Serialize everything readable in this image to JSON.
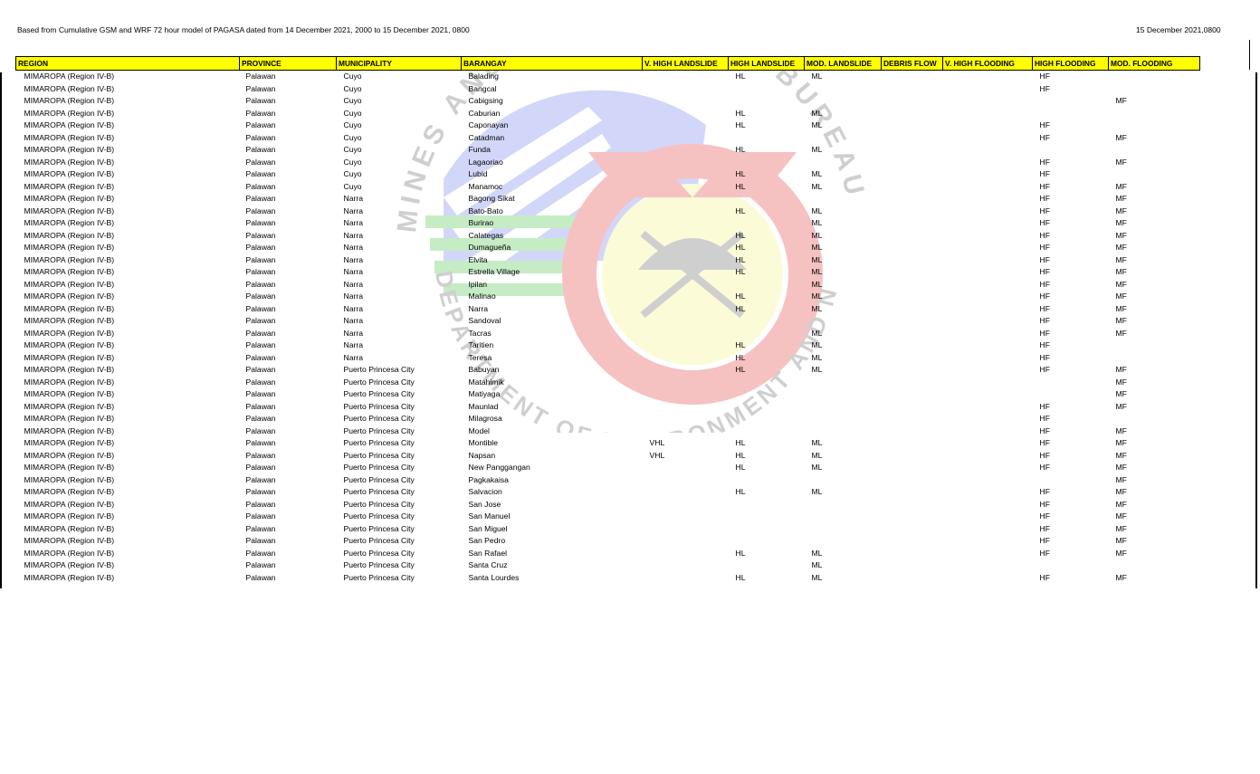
{
  "header": {
    "note": "Based from Cumulative GSM and WRF 72 hour model of PAGASA dated from 14 December 2021, 2000 to 15 December 2021, 0800",
    "date": "15 December 2021,0800"
  },
  "watermark": {
    "top_text": "MINES AND GEOSCIENCES BUREAU",
    "bottom_text": "DEPARTMENT OF ENVIRONMENT AND NATURAL RESOURCES"
  },
  "table": {
    "columns": [
      "REGION",
      "PROVINCE",
      "MUNICIPALITY",
      "BARANGAY",
      "V. HIGH LANDSLIDE",
      "HIGH LANDSLIDE",
      "MOD. LANDSLIDE",
      "DEBRIS FLOW",
      "V. HIGH FLOODING",
      "HIGH FLOODING",
      "MOD. FLOODING"
    ],
    "rows": [
      [
        "MIMAROPA (Region IV-B)",
        "Palawan",
        "Cuyo",
        "Balading",
        "",
        "HL",
        "ML",
        "",
        "",
        "HF",
        ""
      ],
      [
        "MIMAROPA (Region IV-B)",
        "Palawan",
        "Cuyo",
        "Bangcal",
        "",
        "",
        "",
        "",
        "",
        "HF",
        ""
      ],
      [
        "MIMAROPA (Region IV-B)",
        "Palawan",
        "Cuyo",
        "Cabigsing",
        "",
        "",
        "",
        "",
        "",
        "",
        "MF"
      ],
      [
        "MIMAROPA (Region IV-B)",
        "Palawan",
        "Cuyo",
        "Caburian",
        "",
        "HL",
        "ML",
        "",
        "",
        "",
        ""
      ],
      [
        "MIMAROPA (Region IV-B)",
        "Palawan",
        "Cuyo",
        "Caponayan",
        "",
        "HL",
        "ML",
        "",
        "",
        "HF",
        ""
      ],
      [
        "MIMAROPA (Region IV-B)",
        "Palawan",
        "Cuyo",
        "Catadman",
        "",
        "",
        "",
        "",
        "",
        "HF",
        "MF"
      ],
      [
        "MIMAROPA (Region IV-B)",
        "Palawan",
        "Cuyo",
        "Funda",
        "",
        "HL",
        "ML",
        "",
        "",
        "",
        ""
      ],
      [
        "MIMAROPA (Region IV-B)",
        "Palawan",
        "Cuyo",
        "Lagaoriao",
        "",
        "",
        "",
        "",
        "",
        "HF",
        "MF"
      ],
      [
        "MIMAROPA (Region IV-B)",
        "Palawan",
        "Cuyo",
        "Lubid",
        "",
        "HL",
        "ML",
        "",
        "",
        "HF",
        ""
      ],
      [
        "MIMAROPA (Region IV-B)",
        "Palawan",
        "Cuyo",
        "Manamoc",
        "",
        "HL",
        "ML",
        "",
        "",
        "HF",
        "MF"
      ],
      [
        "MIMAROPA (Region IV-B)",
        "Palawan",
        "Narra",
        "Bagong Sikat",
        "",
        "",
        "",
        "",
        "",
        "HF",
        "MF"
      ],
      [
        "MIMAROPA (Region IV-B)",
        "Palawan",
        "Narra",
        "Bato-Bato",
        "",
        "HL",
        "ML",
        "",
        "",
        "HF",
        "MF"
      ],
      [
        "MIMAROPA (Region IV-B)",
        "Palawan",
        "Narra",
        "Burirao",
        "",
        "",
        "ML",
        "",
        "",
        "HF",
        "MF"
      ],
      [
        "MIMAROPA (Region IV-B)",
        "Palawan",
        "Narra",
        "Calategas",
        "",
        "HL",
        "ML",
        "",
        "",
        "HF",
        "MF"
      ],
      [
        "MIMAROPA (Region IV-B)",
        "Palawan",
        "Narra",
        "Dumagueña",
        "",
        "HL",
        "ML",
        "",
        "",
        "HF",
        "MF"
      ],
      [
        "MIMAROPA (Region IV-B)",
        "Palawan",
        "Narra",
        "Elvita",
        "",
        "HL",
        "ML",
        "",
        "",
        "HF",
        "MF"
      ],
      [
        "MIMAROPA (Region IV-B)",
        "Palawan",
        "Narra",
        "Estrella Village",
        "",
        "HL",
        "ML",
        "",
        "",
        "HF",
        "MF"
      ],
      [
        "MIMAROPA (Region IV-B)",
        "Palawan",
        "Narra",
        "Ipilan",
        "",
        "",
        "ML",
        "",
        "",
        "HF",
        "MF"
      ],
      [
        "MIMAROPA (Region IV-B)",
        "Palawan",
        "Narra",
        "Malinao",
        "",
        "HL",
        "ML",
        "",
        "",
        "HF",
        "MF"
      ],
      [
        "MIMAROPA (Region IV-B)",
        "Palawan",
        "Narra",
        "Narra",
        "",
        "HL",
        "ML",
        "",
        "",
        "HF",
        "MF"
      ],
      [
        "MIMAROPA (Region IV-B)",
        "Palawan",
        "Narra",
        "Sandoval",
        "",
        "",
        "",
        "",
        "",
        "HF",
        "MF"
      ],
      [
        "MIMAROPA (Region IV-B)",
        "Palawan",
        "Narra",
        "Tacras",
        "",
        "",
        "ML",
        "",
        "",
        "HF",
        "MF"
      ],
      [
        "MIMAROPA (Region IV-B)",
        "Palawan",
        "Narra",
        "Taritien",
        "",
        "HL",
        "ML",
        "",
        "",
        "HF",
        ""
      ],
      [
        "MIMAROPA (Region IV-B)",
        "Palawan",
        "Narra",
        "Teresa",
        "",
        "HL",
        "ML",
        "",
        "",
        "HF",
        ""
      ],
      [
        "MIMAROPA (Region IV-B)",
        "Palawan",
        "Puerto Princesa City",
        "Babuyan",
        "",
        "HL",
        "ML",
        "",
        "",
        "HF",
        "MF"
      ],
      [
        "MIMAROPA (Region IV-B)",
        "Palawan",
        "Puerto Princesa City",
        "Matahimik",
        "",
        "",
        "",
        "",
        "",
        "",
        "MF"
      ],
      [
        "MIMAROPA (Region IV-B)",
        "Palawan",
        "Puerto Princesa City",
        "Matiyaga",
        "",
        "",
        "",
        "",
        "",
        "",
        "MF"
      ],
      [
        "MIMAROPA (Region IV-B)",
        "Palawan",
        "Puerto Princesa City",
        "Maunlad",
        "",
        "",
        "",
        "",
        "",
        "HF",
        "MF"
      ],
      [
        "MIMAROPA (Region IV-B)",
        "Palawan",
        "Puerto Princesa City",
        "Milagrosa",
        "",
        "",
        "",
        "",
        "",
        "HF",
        ""
      ],
      [
        "MIMAROPA (Region IV-B)",
        "Palawan",
        "Puerto Princesa City",
        "Model",
        "",
        "",
        "",
        "",
        "",
        "HF",
        "MF"
      ],
      [
        "MIMAROPA (Region IV-B)",
        "Palawan",
        "Puerto Princesa City",
        "Montible",
        "VHL",
        "HL",
        "ML",
        "",
        "",
        "HF",
        "MF"
      ],
      [
        "MIMAROPA (Region IV-B)",
        "Palawan",
        "Puerto Princesa City",
        "Napsan",
        "VHL",
        "HL",
        "ML",
        "",
        "",
        "HF",
        "MF"
      ],
      [
        "MIMAROPA (Region IV-B)",
        "Palawan",
        "Puerto Princesa City",
        "New Panggangan",
        "",
        "HL",
        "ML",
        "",
        "",
        "HF",
        "MF"
      ],
      [
        "MIMAROPA (Region IV-B)",
        "Palawan",
        "Puerto Princesa City",
        "Pagkakaisa",
        "",
        "",
        "",
        "",
        "",
        "",
        "MF"
      ],
      [
        "MIMAROPA (Region IV-B)",
        "Palawan",
        "Puerto Princesa City",
        "Salvacion",
        "",
        "HL",
        "ML",
        "",
        "",
        "HF",
        "MF"
      ],
      [
        "MIMAROPA (Region IV-B)",
        "Palawan",
        "Puerto Princesa City",
        "San Jose",
        "",
        "",
        "",
        "",
        "",
        "HF",
        "MF"
      ],
      [
        "MIMAROPA (Region IV-B)",
        "Palawan",
        "Puerto Princesa City",
        "San Manuel",
        "",
        "",
        "",
        "",
        "",
        "HF",
        "MF"
      ],
      [
        "MIMAROPA (Region IV-B)",
        "Palawan",
        "Puerto Princesa City",
        "San Miguel",
        "",
        "",
        "",
        "",
        "",
        "HF",
        "MF"
      ],
      [
        "MIMAROPA (Region IV-B)",
        "Palawan",
        "Puerto Princesa City",
        "San Pedro",
        "",
        "",
        "",
        "",
        "",
        "HF",
        "MF"
      ],
      [
        "MIMAROPA (Region IV-B)",
        "Palawan",
        "Puerto Princesa City",
        "San Rafael",
        "",
        "HL",
        "ML",
        "",
        "",
        "HF",
        "MF"
      ],
      [
        "MIMAROPA (Region IV-B)",
        "Palawan",
        "Puerto Princesa City",
        "Santa Cruz",
        "",
        "",
        "ML",
        "",
        "",
        "",
        ""
      ],
      [
        "MIMAROPA (Region IV-B)",
        "Palawan",
        "Puerto Princesa City",
        "Santa Lourdes",
        "",
        "HL",
        "ML",
        "",
        "",
        "HF",
        "MF"
      ]
    ]
  }
}
